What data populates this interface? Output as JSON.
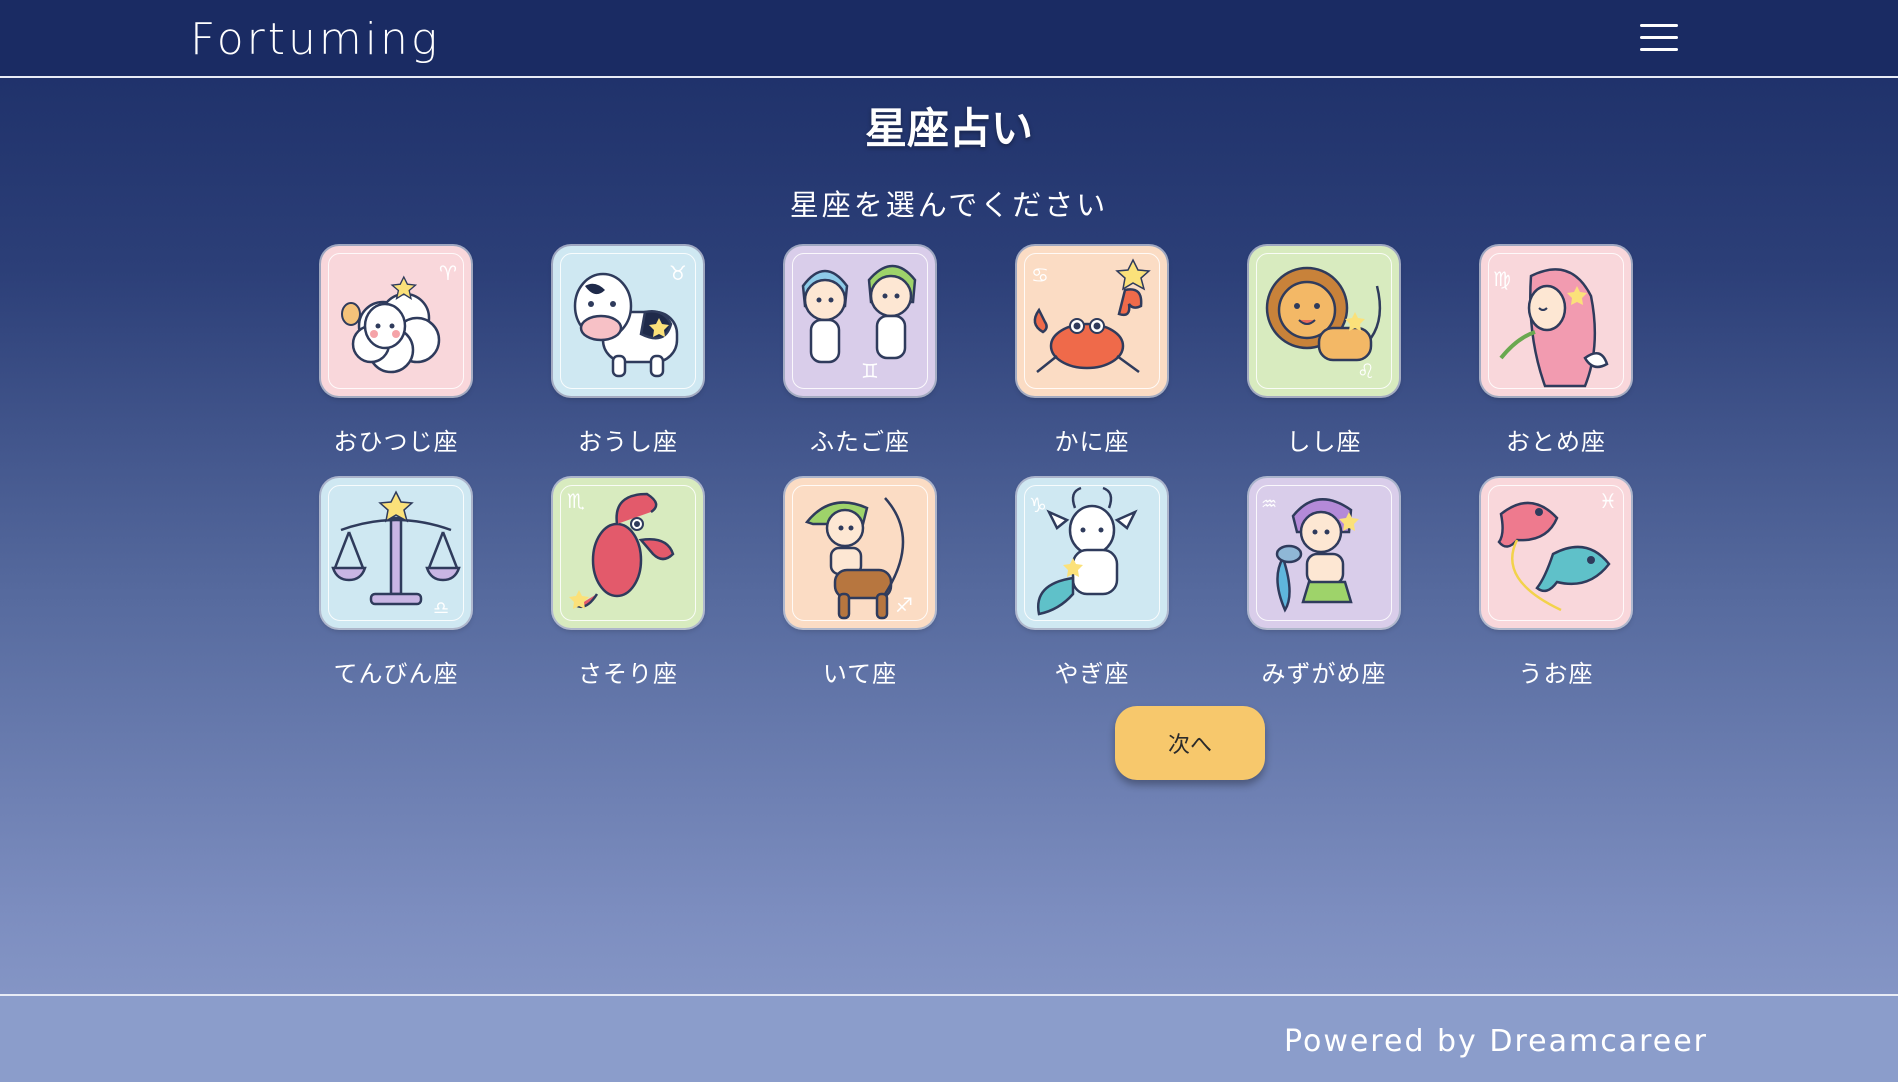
{
  "header": {
    "logo": "Fortuming",
    "menu_icon": "hamburger-menu-icon"
  },
  "page": {
    "title": "星座占い",
    "subtitle": "星座を選んでください"
  },
  "signs": [
    {
      "label": "おひつじ座",
      "icon": "aries-sheep-icon",
      "bg": "#f9d7db"
    },
    {
      "label": "おうし座",
      "icon": "taurus-cow-icon",
      "bg": "#cfe8f2"
    },
    {
      "label": "ふたご座",
      "icon": "gemini-twins-icon",
      "bg": "#d9cdea"
    },
    {
      "label": "かに座",
      "icon": "cancer-crab-icon",
      "bg": "#fbdcc4"
    },
    {
      "label": "しし座",
      "icon": "leo-lion-icon",
      "bg": "#d8ebbf"
    },
    {
      "label": "おとめ座",
      "icon": "virgo-maiden-icon",
      "bg": "#f9d7db"
    },
    {
      "label": "てんびん座",
      "icon": "libra-scales-icon",
      "bg": "#cfe8f2"
    },
    {
      "label": "さそり座",
      "icon": "scorpio-scorpion-icon",
      "bg": "#d8ebbf"
    },
    {
      "label": "いて座",
      "icon": "sagittarius-archer-icon",
      "bg": "#fbdcc4"
    },
    {
      "label": "やぎ座",
      "icon": "capricorn-goat-icon",
      "bg": "#cfe8f2"
    },
    {
      "label": "みずがめ座",
      "icon": "aquarius-water-bearer-icon",
      "bg": "#d9cdea"
    },
    {
      "label": "うお座",
      "icon": "pisces-fish-icon",
      "bg": "#f9d7db"
    }
  ],
  "actions": {
    "next_label": "次へ"
  },
  "footer": {
    "powered_by": "Powered by Dreamcareer"
  },
  "colors": {
    "header_bg": "#1a2b63",
    "button": "#f7c86c"
  }
}
